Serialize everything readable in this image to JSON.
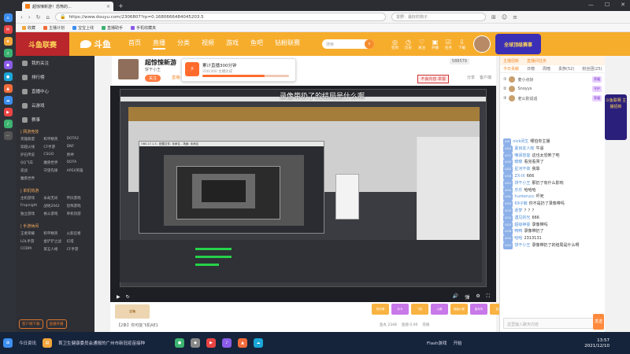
{
  "browser": {
    "tab_title": "超惊悚新游！恐怖的...",
    "url": "https://www.douyu.com/2306807?rp=0.1680666484045203.5",
    "search_placeholder": "雷野：最好的狗子",
    "bookmarks": [
      "收藏",
      "主播计划",
      "宝宝上线",
      "直播助手",
      "手机收藏夹"
    ]
  },
  "site": {
    "logo_badge": "斗鱼联赛",
    "brand": "斗鱼",
    "nav": [
      "首页",
      "直播",
      "分类",
      "视频",
      "游戏",
      "鱼吧",
      "钻粉联赛"
    ],
    "search_placeholder": "搜索",
    "header_icons": [
      "签到",
      "历史",
      "关注",
      "开播",
      "任务",
      "下载"
    ],
    "banner_badge": "全球顶级赛事"
  },
  "left_nav": {
    "items": [
      "我的关注",
      "排行榜",
      "直播中心",
      "云游戏",
      "赛事"
    ],
    "groups": [
      {
        "title": "| 网游竞技",
        "entries": [
          "英雄联盟",
          "和平精英",
          "DOTA2",
          "穿越火线",
          "CF手游",
          "DNF",
          "炉石传说",
          "CSGO",
          "原神",
          "QQ飞车",
          "魔兽世界",
          "DOTA",
          "逆战",
          "守望先锋",
          "APEX英雄",
          "魔兽世界"
        ]
      },
      {
        "title": "| 单机热游",
        "entries": [
          "主机游戏",
          "永劫无间",
          "怀旧游戏",
          "Fropnight",
          "战地2042",
          "恐怖游戏",
          "独立游戏",
          "格斗游戏",
          "单机热游"
        ]
      },
      {
        "title": "| 手游休闲",
        "entries": [
          "王者荣耀",
          "和平精英",
          "火影忍者",
          "LOL手游",
          "金铲铲之战",
          "幻塔",
          "CODM",
          "第五人格",
          "CF手游"
        ]
      }
    ],
    "bottom_buttons": [
      "客户端下载",
      "直播开播"
    ]
  },
  "anchor": {
    "title": "超惊悚新游",
    "name": "饼干小王",
    "follow_label": "关注",
    "level_label": "直播小王",
    "hot": "588579",
    "report_label": "不良内容·举报",
    "actions": [
      "分享",
      "客户端"
    ]
  },
  "popup": {
    "title": "累计直播300分钟",
    "subtitle": "200/300 主播达成",
    "progress": 0.72
  },
  "video": {
    "subtitle": "录像带扔了的结局是什么啊",
    "controls": [
      "播放",
      "刷新",
      "音量",
      "弹幕",
      "全屏"
    ]
  },
  "gift": {
    "box_text": "宝箱",
    "desc": "【2条】你可能飞机AE1",
    "items": [
      "荧光棒",
      "办卡",
      "飞机",
      "火箭",
      "超级火箭",
      "嘉年华",
      "告白"
    ],
    "bar": [
      "鱼丸 2348",
      "鱼翅 0.00",
      "充值"
    ]
  },
  "right_panel": {
    "header_tabs": [
      "主播招新",
      "直播间任务"
    ],
    "tabs": [
      "今日贡献",
      "日榜",
      "周榜",
      "贵族(52)",
      "粉丝团(25)"
    ],
    "ranking": [
      {
        "name": "麦小点好",
        "badge": "荣耀"
      },
      {
        "name": "Snoyys",
        "badge": "守护"
      },
      {
        "name": "老公别说话",
        "badge": "荣耀"
      }
    ],
    "chat": [
      {
        "lv": "LV9",
        "user": "nick闲生",
        "msg": "哪怕你主播"
      },
      {
        "lv": "LV24",
        "user": "夏目友人帐",
        "msg": "牛逼"
      },
      {
        "lv": "LV17",
        "user": "嘲讽技能",
        "msg": "这也太恐怖了吧"
      },
      {
        "lv": "LV19",
        "user": "暖暖",
        "msg": "看完看哭了"
      },
      {
        "lv": "LV22",
        "user": "星河不夜",
        "msg": "我靠"
      },
      {
        "lv": "LV18",
        "user": "ZX-IX",
        "msg": "666"
      },
      {
        "lv": "LV21",
        "user": "饼干小王",
        "msg": "那扔了有什么影响"
      },
      {
        "lv": "LV14",
        "user": "乐乐",
        "msg": "哈哈哈"
      },
      {
        "lv": "LV20",
        "user": "hunterucc",
        "msg": "吓死"
      },
      {
        "lv": "LV24",
        "user": "69子敏",
        "msg": "你不是扔了录像带吗"
      },
      {
        "lv": "LV13",
        "user": "逐梦",
        "msg": "？？？"
      },
      {
        "lv": "LV11",
        "user": "遇见的光",
        "msg": "666"
      },
      {
        "lv": "LV23",
        "user": "超级神豪",
        "msg": "录像带吗"
      },
      {
        "lv": "LV16",
        "user": "鸭鸭",
        "msg": "录像带扔了"
      },
      {
        "lv": "LV14",
        "user": "哈哈",
        "msg": "2313131"
      },
      {
        "lv": "LV24",
        "user": "饼干小王",
        "msg": "录像带扔了的结局是什么啊"
      }
    ],
    "input_placeholder": "这里输入聊天内容",
    "send_label": "发送"
  },
  "side_badge": "斗鱼联赛 主播招新",
  "taskbar": {
    "weather": "今日资讯",
    "news": "首卫生健康委员会通报的广州市新冠疫苗接种",
    "items": [
      "Flash游戏",
      "开始"
    ],
    "time": "13:57",
    "date": "2021/12/10"
  }
}
